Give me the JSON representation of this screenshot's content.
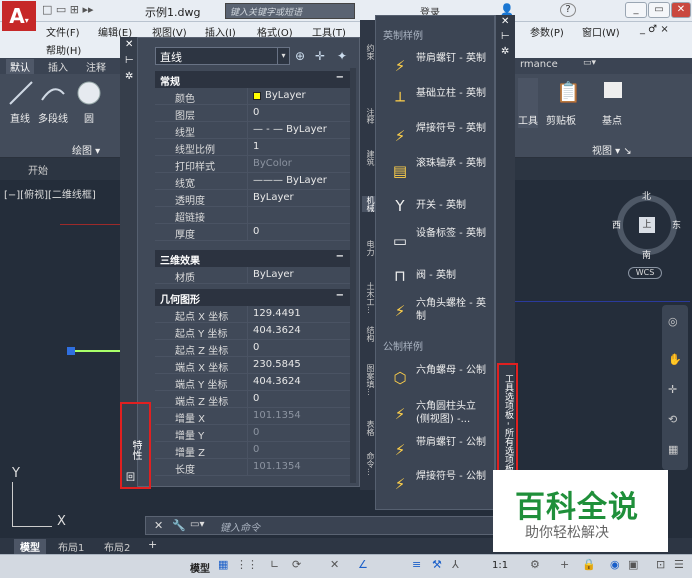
{
  "app": {
    "filename": "示例1.dwg",
    "search_placeholder": "键入关键字或短语",
    "login": "登录",
    "help_icon": "?",
    "menus": [
      "文件(F)",
      "编辑(E)",
      "视图(V)",
      "插入(I)",
      "格式(O)",
      "工具(T)",
      "参数(P)",
      "窗口(W)"
    ],
    "help_menu": "帮助(H)",
    "winctl": [
      "_",
      "▭",
      "✕"
    ],
    "winctl2": "_ ♂ ×"
  },
  "ribbon": {
    "tabs": [
      "默认",
      "插入",
      "注释"
    ],
    "perf_tab": "rmance",
    "draw_tools": [
      "直线",
      "多段线",
      "圆",
      "圆"
    ],
    "draw_panel": "绘图 ▾",
    "right_tools": [
      "工具",
      "剪贴板",
      "基点"
    ],
    "view_panel": "视图 ▾ ↘"
  },
  "doc": {
    "start_tab": "开始",
    "viewport_label": "[−][俯视][二维线框]",
    "compass": {
      "n": "北",
      "s": "南",
      "e": "东",
      "w": "西",
      "top": "上"
    },
    "wcs": "WCS",
    "ucs_y": "Y",
    "ucs_x": "X"
  },
  "properties": {
    "strip_title": "特性",
    "strip_icon": "回",
    "selector": "直线",
    "sections": [
      {
        "title": "常规",
        "rows": [
          {
            "k": "颜色",
            "v": "ByLayer",
            "swatch": "#ffff00"
          },
          {
            "k": "图层",
            "v": "0"
          },
          {
            "k": "线型",
            "v": "— - — ByLayer"
          },
          {
            "k": "线型比例",
            "v": "1"
          },
          {
            "k": "打印样式",
            "v": "ByColor",
            "dim": true
          },
          {
            "k": "线宽",
            "v": "——— ByLayer"
          },
          {
            "k": "透明度",
            "v": "ByLayer"
          },
          {
            "k": "超链接",
            "v": ""
          },
          {
            "k": "厚度",
            "v": "0"
          }
        ]
      },
      {
        "title": "三维效果",
        "rows": [
          {
            "k": "材质",
            "v": "ByLayer"
          }
        ]
      },
      {
        "title": "几何图形",
        "rows": [
          {
            "k": "起点 X 坐标",
            "v": "129.4491"
          },
          {
            "k": "起点 Y 坐标",
            "v": "404.3624"
          },
          {
            "k": "起点 Z 坐标",
            "v": "0"
          },
          {
            "k": "端点 X 坐标",
            "v": "230.5845"
          },
          {
            "k": "端点 Y 坐标",
            "v": "404.3624"
          },
          {
            "k": "端点 Z 坐标",
            "v": "0"
          },
          {
            "k": "增量 X",
            "v": "101.1354",
            "dim": true
          },
          {
            "k": "增量 Y",
            "v": "0",
            "dim": true
          },
          {
            "k": "增量 Z",
            "v": "0",
            "dim": true
          },
          {
            "k": "长度",
            "v": "101.1354",
            "dim": true
          }
        ]
      }
    ],
    "collapse": "−"
  },
  "side_tabs": [
    "约束",
    "注释",
    "建筑",
    "机械",
    "电力",
    "土木工...",
    "结构",
    "图案填...",
    "表格",
    "命令..."
  ],
  "palette": {
    "cat1": "英制样例",
    "cat2": "公制样例",
    "items1": [
      "带肩螺钉 - 英制",
      "基础立柱 - 英制",
      "焊接符号 - 英制",
      "滚珠轴承 - 英制",
      "开关 - 英制",
      "设备标签 - 英制",
      "阀 - 英制",
      "六角头螺栓 - 英制"
    ],
    "items2": [
      "六角螺母 - 公制",
      "六角圆柱头立 (侧视图) -...",
      "带肩螺钉 - 公制",
      "焊接符号 - 公制"
    ],
    "vertical_title": "工具选项板 - 所有选项板"
  },
  "cmd": {
    "placeholder": "键入命令"
  },
  "layouts": [
    "模型",
    "布局1",
    "布局2",
    "+"
  ],
  "status": {
    "model": "模型",
    "scale": "1:1"
  },
  "watermark": {
    "title": "百科全说",
    "subtitle": "助你轻松解决"
  },
  "colors": {
    "accent_red": "#e02020",
    "line_selected": "#2f6fe0",
    "bylayer_swatch": "#ffff00"
  }
}
